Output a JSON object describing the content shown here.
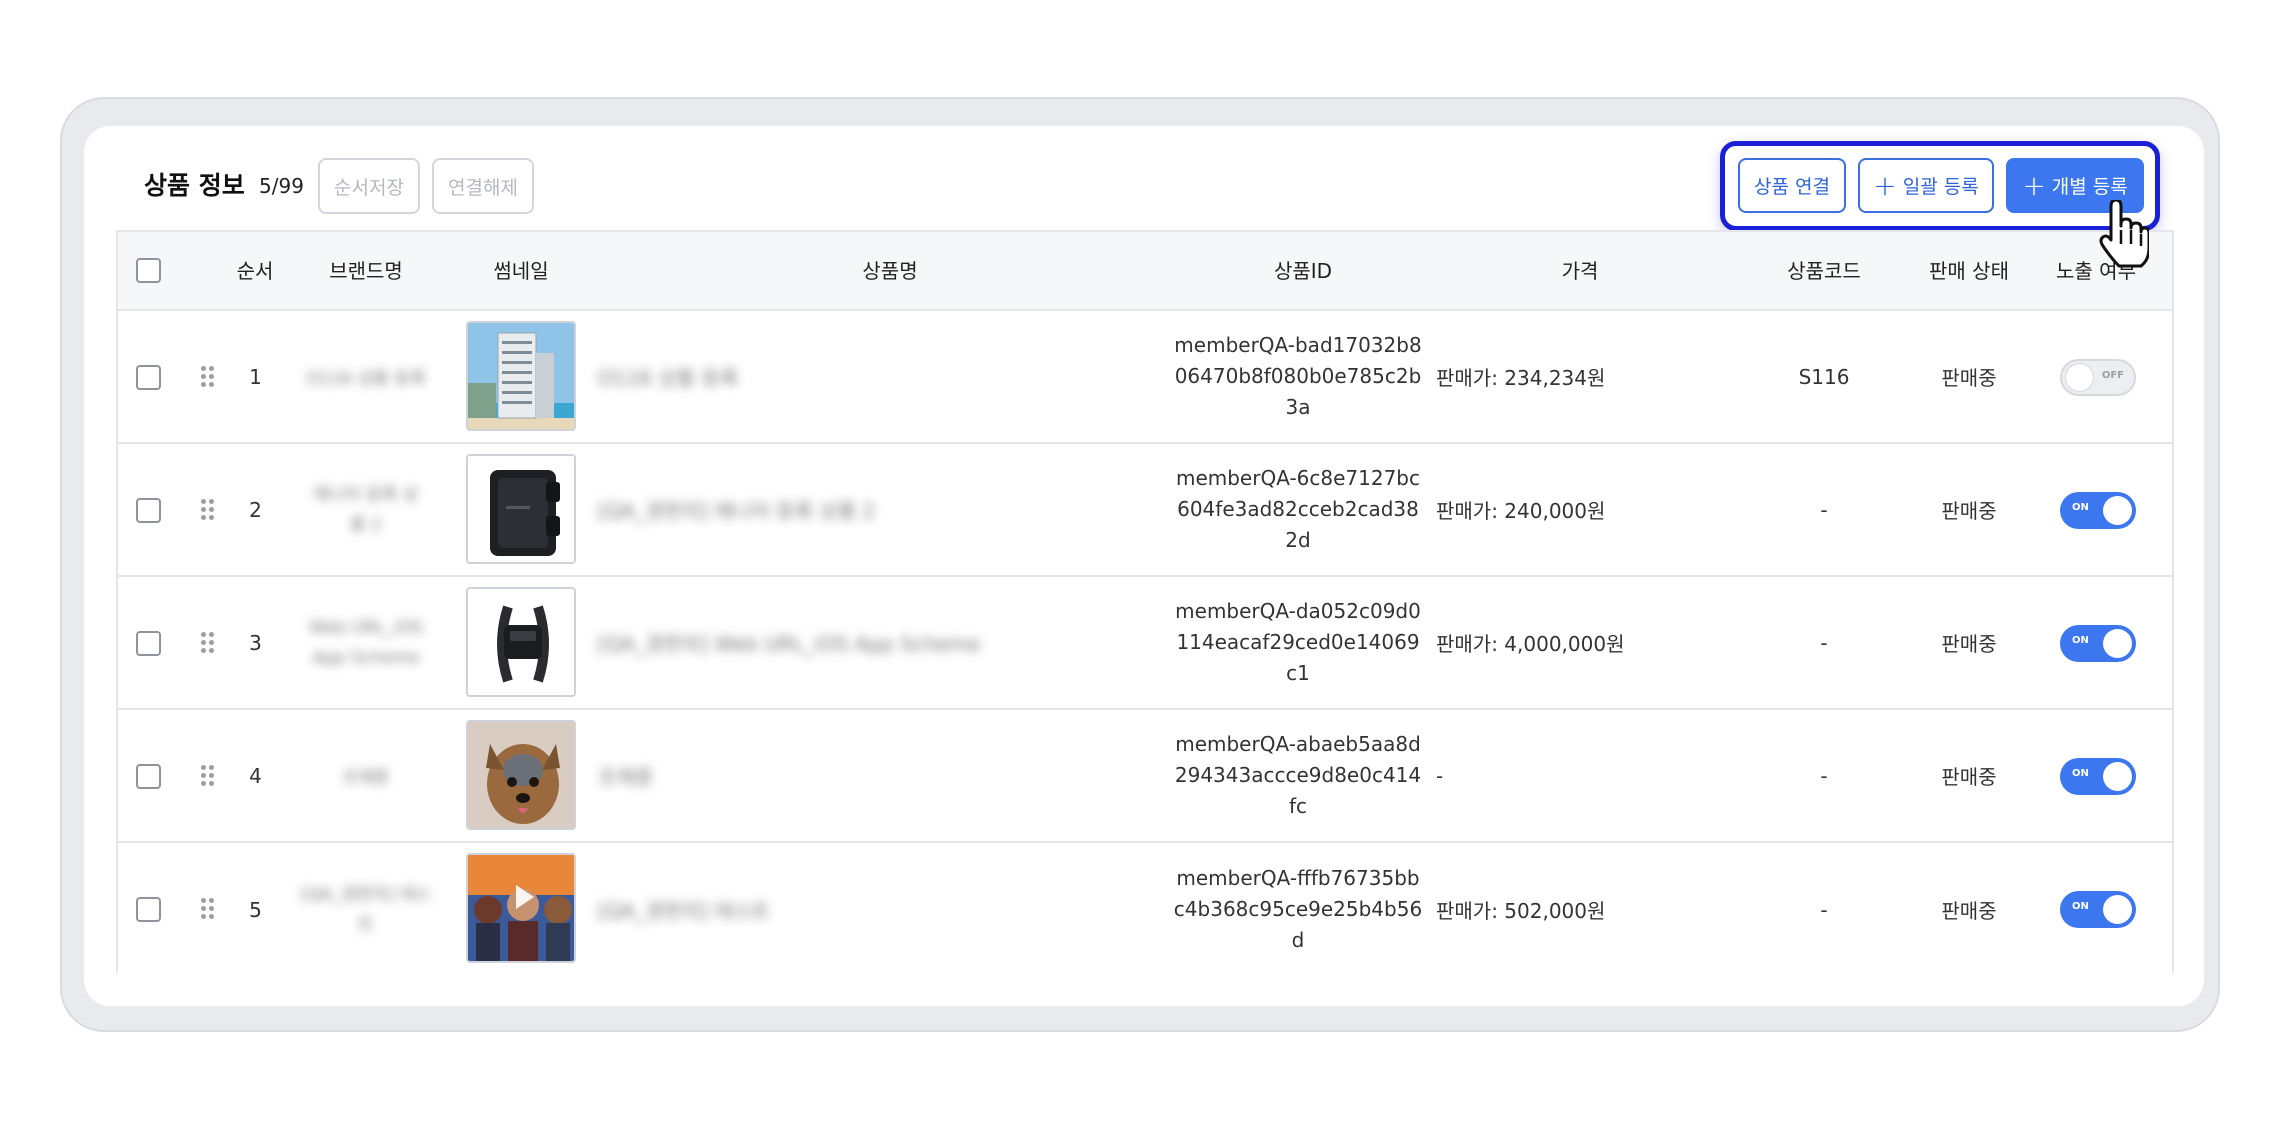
{
  "header": {
    "title": "상품 정보",
    "count": "5/99",
    "save_order_label": "순서저장",
    "unlink_label": "연결해제",
    "link_product_label": "상품 연결",
    "bulk_register_label": "일괄 등록",
    "individual_register_label": "개별 등록"
  },
  "columns": {
    "order": "순서",
    "brand": "브랜드명",
    "thumbnail": "썸네일",
    "product_name": "상품명",
    "product_id": "상품ID",
    "price": "가격",
    "product_code": "상품코드",
    "sale_status": "판매 상태",
    "exposure": "노출 여부"
  },
  "rows": [
    {
      "order": "1",
      "brand": "O116 상품 등록",
      "name": "O116 상품 등록",
      "product_id": "memberQA-bad17032b806470b8f080b0e785c2b3a",
      "price": "판매가: 234,234원",
      "code": "S116",
      "status": "판매중",
      "exposed": false,
      "toggle_label": "OFF",
      "thumb_icon": "hotel-image"
    },
    {
      "order": "2",
      "brand": "에니어 등록 상품 2",
      "name": "[QA_경한의] 에니어 등록 상품 2",
      "product_id": "memberQA-6c8e7127bc604fe3ad82cceb2cad382d",
      "price": "판매가: 240,000원",
      "code": "-",
      "status": "판매중",
      "exposed": true,
      "toggle_label": "ON",
      "thumb_icon": "phone-case-image"
    },
    {
      "order": "3",
      "brand": "Web URL_iOS App Scheme",
      "name": "[QA_경한의] Web URL_iOS App Scheme",
      "product_id": "memberQA-da052c09d0114eacaf29ced0e14069c1",
      "price": "판매가: 4,000,000원",
      "code": "-",
      "status": "판매중",
      "exposed": true,
      "toggle_label": "ON",
      "thumb_icon": "pet-collar-image"
    },
    {
      "order": "4",
      "brand": "조재훈",
      "name": "조재훈",
      "product_id": "memberQA-abaeb5aa8d294343accce9d8e0c414fc",
      "price": "-",
      "code": "-",
      "status": "판매중",
      "exposed": true,
      "toggle_label": "ON",
      "thumb_icon": "dog-image"
    },
    {
      "order": "5",
      "brand": "[QA_경한의] 테스트",
      "name": "[QA_경한의] 테스트",
      "product_id": "memberQA-fffb76735bbc4b368c95ce9e25b4b56d",
      "price": "판매가: 502,000원",
      "code": "-",
      "status": "판매중",
      "exposed": true,
      "toggle_label": "ON",
      "thumb_icon": "movie-poster-image"
    }
  ],
  "colors": {
    "accent": "#3c77f0",
    "highlight_border": "#1a1fd8",
    "outline_text": "#2e63d9"
  }
}
